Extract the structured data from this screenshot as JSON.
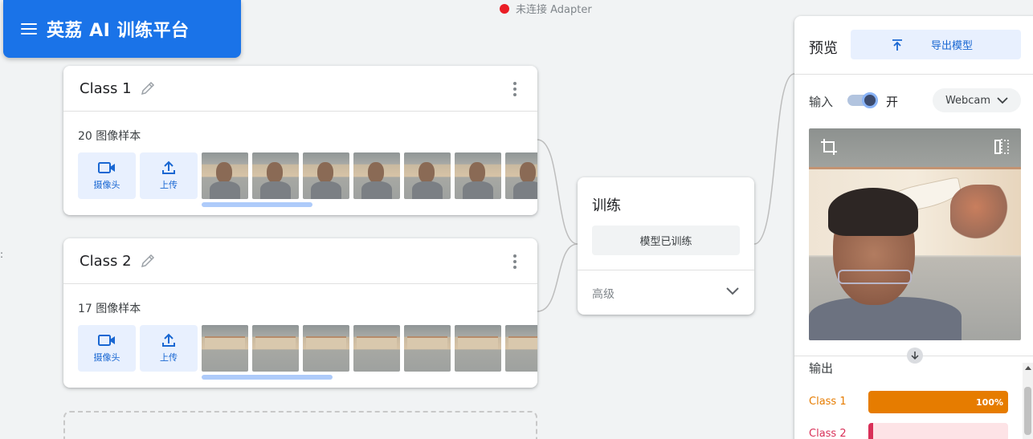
{
  "app": {
    "title": "英荔 AI 训练平台",
    "menu_icon": "menu-icon"
  },
  "connection": {
    "status_text": "未连接 Adapter",
    "color": "#ea1d25"
  },
  "left_edge": {
    "text": ":"
  },
  "classes": [
    {
      "name": "Class 1",
      "sample_count": "20 图像样本",
      "thumb_kinds": [
        "face",
        "face",
        "face",
        "face",
        "face",
        "face",
        "face"
      ],
      "webcam_label": "摄像头",
      "upload_label": "上传",
      "scroll_fraction": 0.33
    },
    {
      "name": "Class 2",
      "sample_count": "17 图像样本",
      "thumb_kinds": [
        "wall",
        "wall",
        "wall",
        "wall",
        "wall",
        "wall",
        "wall"
      ],
      "webcam_label": "摄像头",
      "upload_label": "上传",
      "scroll_fraction": 0.39
    }
  ],
  "training": {
    "title": "训练",
    "trained_button": "模型已训练",
    "advanced_label": "高级"
  },
  "preview": {
    "title": "预览",
    "export_button": "导出模型",
    "input_label": "输入",
    "toggle_state": "开",
    "source_select": "Webcam",
    "output_label": "输出",
    "outputs": [
      {
        "name": "Class 1",
        "value": 1.0,
        "text": "100%",
        "color": "#e67c00",
        "bg": "#fde7d4"
      },
      {
        "name": "Class 2",
        "value": 0.0,
        "text": "",
        "color": "#d93058",
        "bg": "#fde3e6"
      }
    ]
  },
  "colors": {
    "accent": "#1a73e8",
    "chip_bg": "#e8f0fe"
  }
}
